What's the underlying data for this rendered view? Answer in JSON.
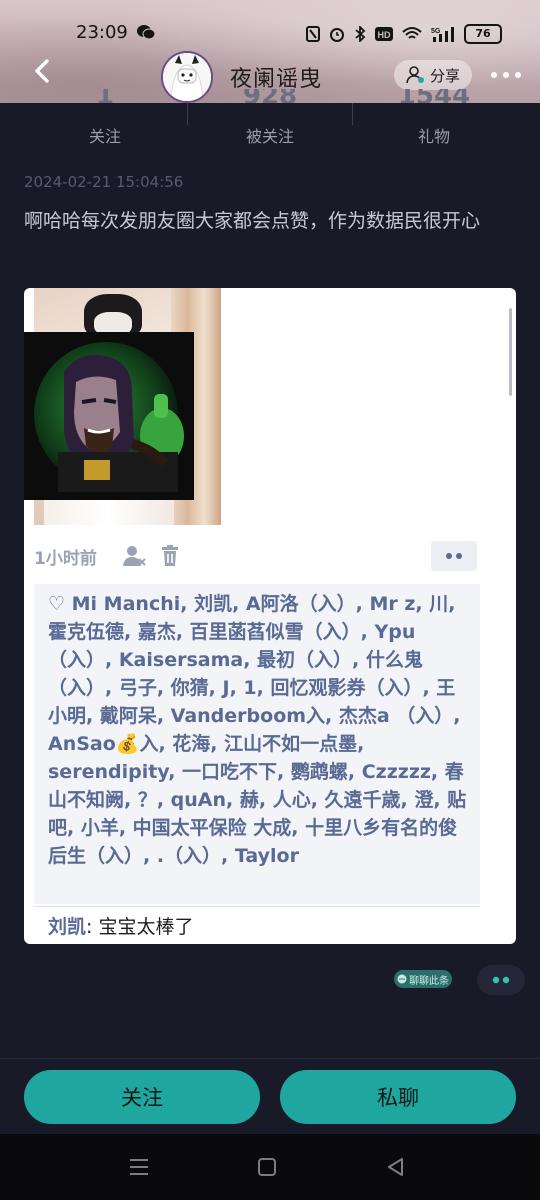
{
  "status_bar": {
    "time": "23:09",
    "battery": "76",
    "icons": [
      "nfc-icon",
      "alarm-icon",
      "bluetooth-icon",
      "hd-icon",
      "wifi-icon",
      "signal-5g-icon",
      "battery-icon"
    ]
  },
  "header": {
    "nickname": "夜阑谣曳",
    "share_label": "分享"
  },
  "stats": [
    {
      "number": "1",
      "label": "关注"
    },
    {
      "number": "928",
      "label": "被关注"
    },
    {
      "number": "1544",
      "label": "礼物"
    }
  ],
  "post": {
    "date": "2024-02-21 15:04:56",
    "text": "啊哈哈每次发朋友圈大家都会点赞，作为数据民很开心"
  },
  "screenshot": {
    "time_ago": "1小时前",
    "likes": "♡ Mi Manchi, 刘凯, A阿洛（入）, Mr z, 川, 霍克伍德, 嘉杰, 百里菡萏似雪（入）, Ypu （入）, Kaisersama, 最初（入）, 什么鬼（入）, 弓子, 你猜, J, 1, 回忆观影券（入）, 王小明, 戴阿呆, Vanderboom入, 杰杰a （入）, AnSao💰入, 花海, 江山不如一点墨, serendipity, 一口吃不下, 鹦鹉螺, Czzzzz, 春山不知阙, ？, quAn, 赫, 人心, 久遠千歳, 澄, 贴吧, 小羊, 中国太平保险 大成, 十里八乡有名的俊后生（入）, .（入）, Taylor",
    "comment_name": "刘凯",
    "comment_sep": ": ",
    "comment_text": "宝宝太棒了"
  },
  "chat_chip_label": "聊聊此条",
  "buttons": {
    "follow": "关注",
    "message": "私聊"
  },
  "colors": {
    "background": "#181a27",
    "accent": "#1fa69f",
    "likes_text": "#596a95"
  }
}
